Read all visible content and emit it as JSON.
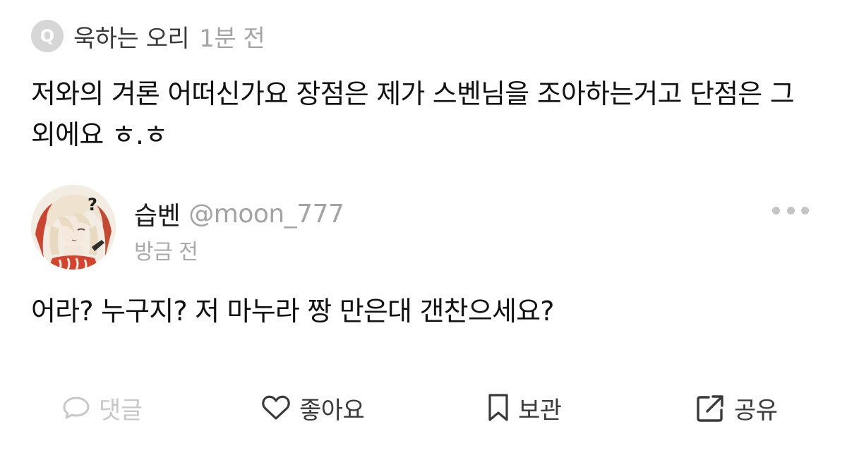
{
  "question": {
    "badge_letter": "Q",
    "author": "욱하는 오리",
    "time": "1분 전",
    "text": "저와의 겨론 어떠신가요 장점은 제가 스벤님을 조아하는거고 단점은 그 외에요 ㅎ.ㅎ"
  },
  "answer": {
    "avatar_icon": "avatar-illustration",
    "name": "습벤",
    "handle": "@moon_777",
    "time": "방금 전",
    "text": "어라? 누구지? 저 마누라 짱 만은대 갠찬으세요?",
    "more_icon": "more-dots-icon"
  },
  "actions": {
    "comment": {
      "label": "댓글",
      "icon": "speech-bubble-icon"
    },
    "like": {
      "label": "좋아요",
      "icon": "heart-icon"
    },
    "save": {
      "label": "보관",
      "icon": "bookmark-icon"
    },
    "share": {
      "label": "공유",
      "icon": "share-arrow-icon"
    }
  },
  "colors": {
    "text": "#111111",
    "meta": "#a5a5a5",
    "icon_dark": "#3a3a3a",
    "icon_disabled": "#c8c8c8",
    "badge": "#d6d6d6"
  }
}
